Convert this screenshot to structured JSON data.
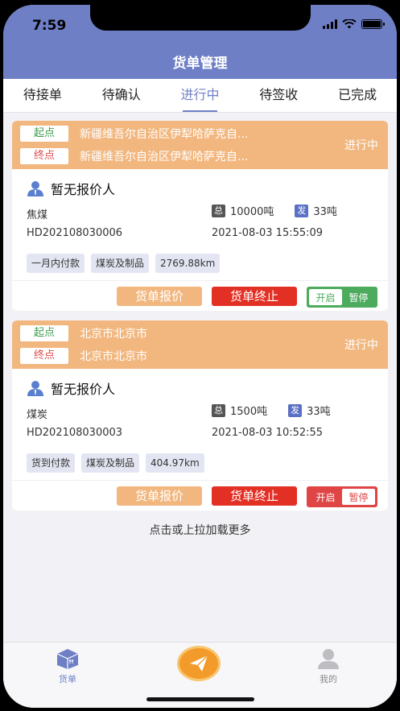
{
  "status_bar": {
    "time": "7:59"
  },
  "header": {
    "title": "货单管理"
  },
  "tabs": [
    {
      "label": "待接单"
    },
    {
      "label": "待确认"
    },
    {
      "label": "进行中",
      "active": true
    },
    {
      "label": "待签收"
    },
    {
      "label": "已完成"
    }
  ],
  "orders": [
    {
      "start_label": "起点",
      "start": "新疆维吾尔自治区伊犁哈萨克自...",
      "end_label": "终点",
      "end": "新疆维吾尔自治区伊犁哈萨克自...",
      "state": "进行中",
      "bidder": "暂无报价人",
      "cargo": "焦煤",
      "total_badge": "总",
      "total": "10000吨",
      "sent_badge": "发",
      "sent": "33吨",
      "order_no": "HD202108030006",
      "time": "2021-08-03 15:55:09",
      "chips": [
        "一月内付款",
        "煤炭及制品",
        "2769.88km"
      ],
      "quote_button": "货单报价",
      "stop_button": "货单终止",
      "toggle_on": "开启",
      "toggle_off": "暂停",
      "toggle_state": "on"
    },
    {
      "start_label": "起点",
      "start": "北京市北京市",
      "end_label": "终点",
      "end": "北京市北京市",
      "state": "进行中",
      "bidder": "暂无报价人",
      "cargo": "煤炭",
      "total_badge": "总",
      "total": "1500吨",
      "sent_badge": "发",
      "sent": "33吨",
      "order_no": "HD202108030003",
      "time": "2021-08-03 10:52:55",
      "chips": [
        "货到付款",
        "煤炭及制品",
        "404.97km"
      ],
      "quote_button": "货单报价",
      "stop_button": "货单终止",
      "toggle_on": "开启",
      "toggle_off": "暂停",
      "toggle_state": "off"
    }
  ],
  "load_more": "点击或上拉加载更多",
  "tabbar": [
    {
      "label": "货单",
      "icon": "cargo-icon",
      "active": true
    },
    {
      "label": "",
      "icon": "send-icon"
    },
    {
      "label": "我的",
      "icon": "profile-icon"
    }
  ],
  "colors": {
    "primary": "#6e7fc6",
    "route_bg": "#f2b77f",
    "stop_red": "#e33025",
    "toggle_green": "#4cab5c",
    "toggle_red": "#e04545",
    "center_orange": "#f29b2a"
  }
}
